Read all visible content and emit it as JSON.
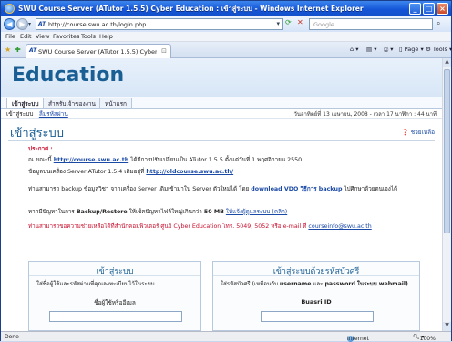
{
  "window": {
    "title": "SWU Course Server (ATutor 1.5.5) Cyber Education : เข้าสู่ระบบ - Windows Internet Explorer",
    "controls": [
      "_",
      "□",
      "×"
    ]
  },
  "addressbar": {
    "url": "http://course.swu.ac.th/login.php",
    "search_placeholder": "Google"
  },
  "menu": [
    "File",
    "Edit",
    "View",
    "Favorites",
    "Tools",
    "Help"
  ],
  "tabbar": {
    "tab_label": "SWU Course Server (ATutor 1.5.5) Cyber Education ...",
    "tools": {
      "page": "Page",
      "tools": "Tools"
    }
  },
  "site": {
    "brand": "Education",
    "nav_tabs": [
      "เข้าสู่ระบบ",
      "สำหรับเจ้าของงาน",
      "หน้าแรก"
    ],
    "breadcrumb_current": "เข้าสู่ระบบ",
    "breadcrumb_link": "ลืมรหัสผ่าน",
    "date_info": "วันอาทิตย์ที่ 13 เมษายน, 2008 - เวลา 17 นาฬิกา : 44 นาที",
    "page_title": "เข้าสู่ระบบ",
    "help_link": "ช่วยเหลือ"
  },
  "announcement": {
    "heading": "ประกาศ :",
    "line1_prefix": "ณ ขณะนี้",
    "line1_link": "http://course.swu.ac.th",
    "line1_suffix": "ได้มีการปรับเปลี่ยนเป็น ATutor 1.5.5 ตั้งแต่วันที่ 1 พฤศจิกายน 2550",
    "line2_prefix": "ข้อมูลบนเครื่อง Server ATutor 1.5.4 เดิมอยู่ที่",
    "line2_link": "http://oldcourse.swu.ac.th/",
    "line3_prefix": "ท่านสามารถ backup ข้อมูลวิชา จากเครื่อง Server เดิมเข้ามาใน Server ตัวใหม่ได้ โดย",
    "line3_link": "download VDO วิธีการ backup",
    "line3_suffix": "ไปศึกษาด้วยตนเองได้",
    "line4_prefix": "หากมีปัญหาในการ",
    "line4_bold": "Backup/Restore",
    "line4_mid": "ให้เช็คปัญหาไฟล์ใหญ่เกินกว่า",
    "line4_size": "50 MB",
    "line4_link": "ให้แจ้งผู้ดูแลระบบ (คลิก)",
    "line5": "ท่านสามารถขอความช่วยเหลือได้ที่สำนักคอมพิวเตอร์ ศูนย์ Cyber Education โทร. 5049, 5052 หรือ e-mail ที่",
    "line5_link": "courseinfo@swu.ac.th"
  },
  "login_left": {
    "heading": "เข้าสู่ระบบ",
    "desc": "ใส่ชื่อผู้ใช้และรหัสผ่านที่คุณลงทะเบียนไว้ในระบบ",
    "field_label": "ชื่อผู้ใช้หรืออีเมล"
  },
  "login_right": {
    "heading": "เข้าสู่ระบบด้วยรหัสบัวศรี",
    "desc_prefix": "ใส่รหัสบัวศรี (เหมือนกับ",
    "desc_bold1": "username",
    "desc_mid": "และ",
    "desc_bold2": "password",
    "desc_suffix": "ในระบบ webmail)",
    "field_label": "Buasri ID"
  },
  "statusbar": {
    "left": "Done",
    "zone": "Internet",
    "zoom": "100%"
  }
}
